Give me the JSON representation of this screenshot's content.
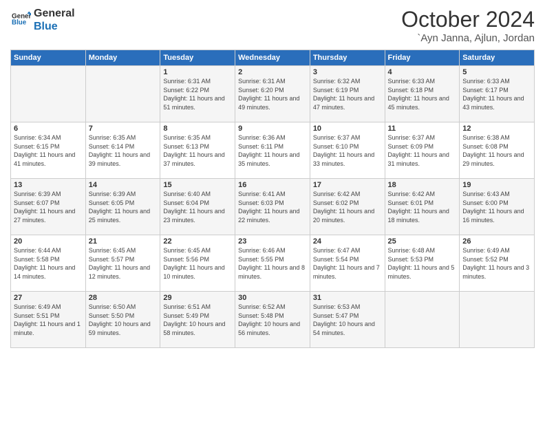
{
  "logo": {
    "line1": "General",
    "line2": "Blue"
  },
  "title": "October 2024",
  "location": "`Ayn Janna, Ajlun, Jordan",
  "days_header": [
    "Sunday",
    "Monday",
    "Tuesday",
    "Wednesday",
    "Thursday",
    "Friday",
    "Saturday"
  ],
  "weeks": [
    [
      {
        "day": "",
        "info": ""
      },
      {
        "day": "",
        "info": ""
      },
      {
        "day": "1",
        "info": "Sunrise: 6:31 AM\nSunset: 6:22 PM\nDaylight: 11 hours and 51 minutes."
      },
      {
        "day": "2",
        "info": "Sunrise: 6:31 AM\nSunset: 6:20 PM\nDaylight: 11 hours and 49 minutes."
      },
      {
        "day": "3",
        "info": "Sunrise: 6:32 AM\nSunset: 6:19 PM\nDaylight: 11 hours and 47 minutes."
      },
      {
        "day": "4",
        "info": "Sunrise: 6:33 AM\nSunset: 6:18 PM\nDaylight: 11 hours and 45 minutes."
      },
      {
        "day": "5",
        "info": "Sunrise: 6:33 AM\nSunset: 6:17 PM\nDaylight: 11 hours and 43 minutes."
      }
    ],
    [
      {
        "day": "6",
        "info": "Sunrise: 6:34 AM\nSunset: 6:15 PM\nDaylight: 11 hours and 41 minutes."
      },
      {
        "day": "7",
        "info": "Sunrise: 6:35 AM\nSunset: 6:14 PM\nDaylight: 11 hours and 39 minutes."
      },
      {
        "day": "8",
        "info": "Sunrise: 6:35 AM\nSunset: 6:13 PM\nDaylight: 11 hours and 37 minutes."
      },
      {
        "day": "9",
        "info": "Sunrise: 6:36 AM\nSunset: 6:11 PM\nDaylight: 11 hours and 35 minutes."
      },
      {
        "day": "10",
        "info": "Sunrise: 6:37 AM\nSunset: 6:10 PM\nDaylight: 11 hours and 33 minutes."
      },
      {
        "day": "11",
        "info": "Sunrise: 6:37 AM\nSunset: 6:09 PM\nDaylight: 11 hours and 31 minutes."
      },
      {
        "day": "12",
        "info": "Sunrise: 6:38 AM\nSunset: 6:08 PM\nDaylight: 11 hours and 29 minutes."
      }
    ],
    [
      {
        "day": "13",
        "info": "Sunrise: 6:39 AM\nSunset: 6:07 PM\nDaylight: 11 hours and 27 minutes."
      },
      {
        "day": "14",
        "info": "Sunrise: 6:39 AM\nSunset: 6:05 PM\nDaylight: 11 hours and 25 minutes."
      },
      {
        "day": "15",
        "info": "Sunrise: 6:40 AM\nSunset: 6:04 PM\nDaylight: 11 hours and 23 minutes."
      },
      {
        "day": "16",
        "info": "Sunrise: 6:41 AM\nSunset: 6:03 PM\nDaylight: 11 hours and 22 minutes."
      },
      {
        "day": "17",
        "info": "Sunrise: 6:42 AM\nSunset: 6:02 PM\nDaylight: 11 hours and 20 minutes."
      },
      {
        "day": "18",
        "info": "Sunrise: 6:42 AM\nSunset: 6:01 PM\nDaylight: 11 hours and 18 minutes."
      },
      {
        "day": "19",
        "info": "Sunrise: 6:43 AM\nSunset: 6:00 PM\nDaylight: 11 hours and 16 minutes."
      }
    ],
    [
      {
        "day": "20",
        "info": "Sunrise: 6:44 AM\nSunset: 5:58 PM\nDaylight: 11 hours and 14 minutes."
      },
      {
        "day": "21",
        "info": "Sunrise: 6:45 AM\nSunset: 5:57 PM\nDaylight: 11 hours and 12 minutes."
      },
      {
        "day": "22",
        "info": "Sunrise: 6:45 AM\nSunset: 5:56 PM\nDaylight: 11 hours and 10 minutes."
      },
      {
        "day": "23",
        "info": "Sunrise: 6:46 AM\nSunset: 5:55 PM\nDaylight: 11 hours and 8 minutes."
      },
      {
        "day": "24",
        "info": "Sunrise: 6:47 AM\nSunset: 5:54 PM\nDaylight: 11 hours and 7 minutes."
      },
      {
        "day": "25",
        "info": "Sunrise: 6:48 AM\nSunset: 5:53 PM\nDaylight: 11 hours and 5 minutes."
      },
      {
        "day": "26",
        "info": "Sunrise: 6:49 AM\nSunset: 5:52 PM\nDaylight: 11 hours and 3 minutes."
      }
    ],
    [
      {
        "day": "27",
        "info": "Sunrise: 6:49 AM\nSunset: 5:51 PM\nDaylight: 11 hours and 1 minute."
      },
      {
        "day": "28",
        "info": "Sunrise: 6:50 AM\nSunset: 5:50 PM\nDaylight: 10 hours and 59 minutes."
      },
      {
        "day": "29",
        "info": "Sunrise: 6:51 AM\nSunset: 5:49 PM\nDaylight: 10 hours and 58 minutes."
      },
      {
        "day": "30",
        "info": "Sunrise: 6:52 AM\nSunset: 5:48 PM\nDaylight: 10 hours and 56 minutes."
      },
      {
        "day": "31",
        "info": "Sunrise: 6:53 AM\nSunset: 5:47 PM\nDaylight: 10 hours and 54 minutes."
      },
      {
        "day": "",
        "info": ""
      },
      {
        "day": "",
        "info": ""
      }
    ]
  ]
}
